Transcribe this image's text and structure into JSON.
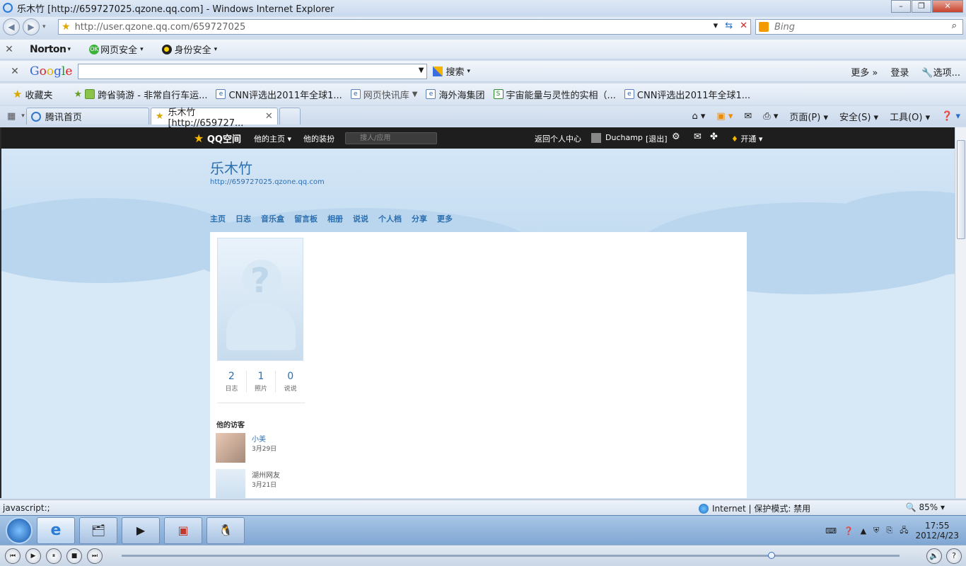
{
  "window": {
    "title": "乐木竹 [http://659727025.qzone.qq.com] - Windows Internet Explorer"
  },
  "address": {
    "url": "http://user.qzone.qq.com/659727025",
    "search_placeholder": "Bing"
  },
  "toolbar1": {
    "norton": "Norton",
    "web_safety": "网页安全",
    "id_safety": "身份安全"
  },
  "google_bar": {
    "search_label": "搜索",
    "more": "更多 »",
    "login": "登录",
    "options": "选项..."
  },
  "favorites": {
    "label": "收藏夹",
    "items": [
      "跨省骑游 - 非常自行车运...",
      "CNN评选出2011年全球1...",
      "网页快讯库",
      "海外海集团",
      "宇宙能量与灵性的实相（...",
      "CNN评选出2011年全球1..."
    ]
  },
  "tabs": [
    {
      "label": "腾讯首页"
    },
    {
      "label": "乐木竹 [http://659727..."
    }
  ],
  "command_bar": {
    "page": "页面(P)",
    "safety": "安全(S)",
    "tools": "工具(O)"
  },
  "qzone_bar": {
    "logo": "QQ空间",
    "his_home": "他的主页",
    "his_decor": "他的装扮",
    "search_placeholder": "搜人/应用",
    "back_center": "返回个人中心",
    "user": "Duchamp",
    "logout": "[退出]",
    "open": "开通"
  },
  "profile": {
    "name": "乐木竹",
    "url": "http://659727025.qzone.qq.com",
    "nav": [
      "主页",
      "日志",
      "音乐盒",
      "留言板",
      "相册",
      "说说",
      "个人档",
      "分享",
      "更多"
    ],
    "stats": [
      {
        "value": "2",
        "label": "日志"
      },
      {
        "value": "1",
        "label": "照片"
      },
      {
        "value": "0",
        "label": "说说"
      }
    ],
    "visitors_heading": "他的访客",
    "visitors": [
      {
        "name": "小美",
        "date": "3月29日"
      },
      {
        "name": "湖州网友",
        "date": "3月21日"
      }
    ]
  },
  "statusbar": {
    "status": "javascript:;",
    "zone": "Internet | 保护模式: 禁用",
    "zoom": "85%"
  },
  "taskbar": {
    "time": "17:55",
    "date": "2012/4/23"
  },
  "media": {
    "progress": 0.835
  }
}
